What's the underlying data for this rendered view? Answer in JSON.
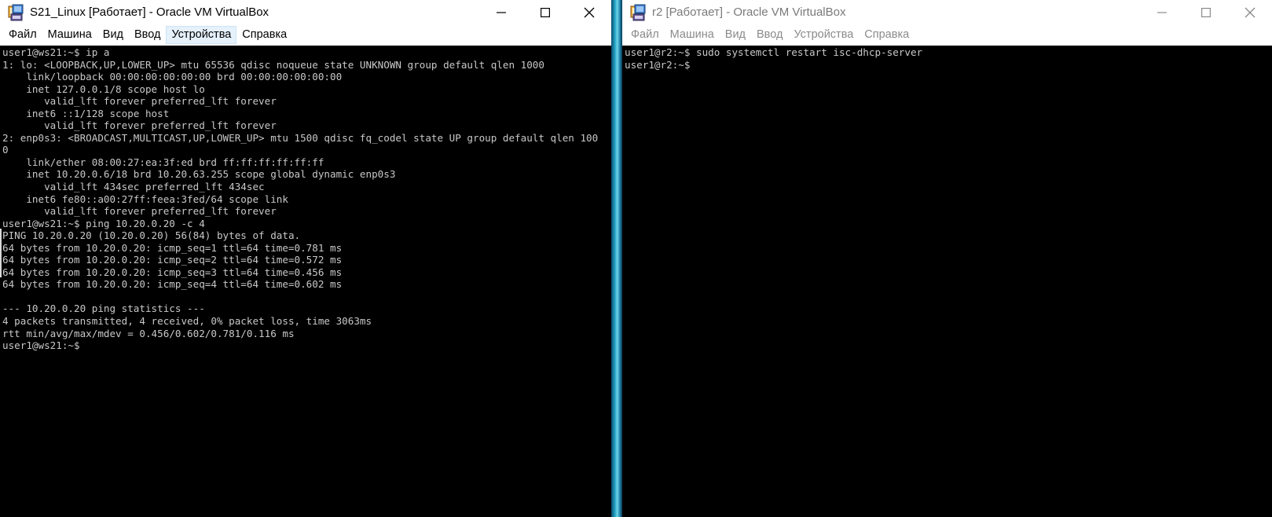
{
  "windows": [
    {
      "title": "S21_Linux [Работает] - Oracle VM VirtualBox",
      "menu": [
        "Файл",
        "Машина",
        "Вид",
        "Ввод",
        "Устройства",
        "Справка"
      ],
      "active_menu": "Устройства",
      "console_lines": [
        "user1@ws21:~$ ip a",
        "1: lo: <LOOPBACK,UP,LOWER_UP> mtu 65536 qdisc noqueue state UNKNOWN group default qlen 1000",
        "    link/loopback 00:00:00:00:00:00 brd 00:00:00:00:00:00",
        "    inet 127.0.0.1/8 scope host lo",
        "       valid_lft forever preferred_lft forever",
        "    inet6 ::1/128 scope host",
        "       valid_lft forever preferred_lft forever",
        "2: enp0s3: <BROADCAST,MULTICAST,UP,LOWER_UP> mtu 1500 qdisc fq_codel state UP group default qlen 100",
        "0",
        "    link/ether 08:00:27:ea:3f:ed brd ff:ff:ff:ff:ff:ff",
        "    inet 10.20.0.6/18 brd 10.20.63.255 scope global dynamic enp0s3",
        "       valid_lft 434sec preferred_lft 434sec",
        "    inet6 fe80::a00:27ff:feea:3fed/64 scope link",
        "       valid_lft forever preferred_lft forever",
        "user1@ws21:~$ ping 10.20.0.20 -c 4",
        "PING 10.20.0.20 (10.20.0.20) 56(84) bytes of data.",
        "64 bytes from 10.20.0.20: icmp_seq=1 ttl=64 time=0.781 ms",
        "64 bytes from 10.20.0.20: icmp_seq=2 ttl=64 time=0.572 ms",
        "64 bytes from 10.20.0.20: icmp_seq=3 ttl=64 time=0.456 ms",
        "64 bytes from 10.20.0.20: icmp_seq=4 ttl=64 time=0.602 ms",
        "",
        "--- 10.20.0.20 ping statistics ---",
        "4 packets transmitted, 4 received, 0% packet loss, time 3063ms",
        "rtt min/avg/max/mdev = 0.456/0.602/0.781/0.116 ms",
        "user1@ws21:~$"
      ]
    },
    {
      "title": "r2 [Работает] - Oracle VM VirtualBox",
      "menu": [
        "Файл",
        "Машина",
        "Вид",
        "Ввод",
        "Устройства",
        "Справка"
      ],
      "active_menu": "",
      "console_lines": [
        "user1@r2:~$ sudo systemctl restart isc-dhcp-server",
        "user1@r2:~$"
      ]
    }
  ],
  "icons": {
    "app": "virtualbox-icon",
    "minimize": "minimize-icon",
    "maximize": "maximize-icon",
    "close": "close-icon"
  },
  "colors": {
    "console_bg": "#000000",
    "console_text": "#c8c8c8",
    "active_menu_bg": "#e5f1fb",
    "inactive_title_text": "#7a7a7a",
    "inactive_menu_text": "#8a8a8a",
    "desktop_strip": "#27a6c8"
  }
}
